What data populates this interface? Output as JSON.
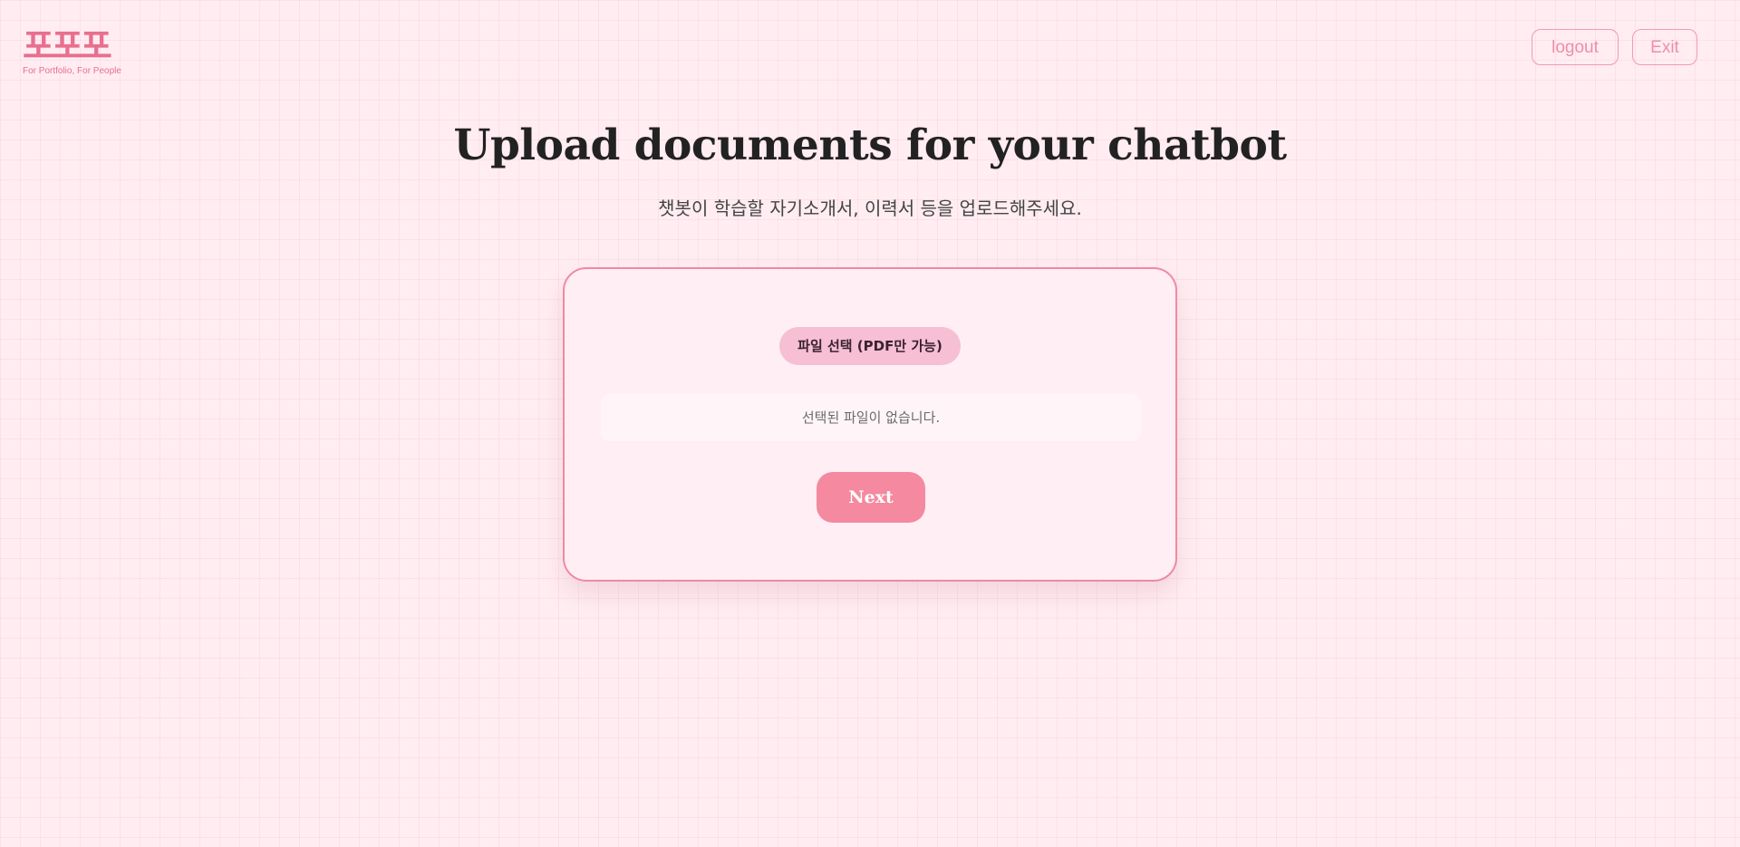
{
  "header": {
    "logo_mark": "포포포",
    "logo_tagline": "For Portfolio, For People",
    "logout_label": "logout",
    "exit_label": "Exit"
  },
  "main": {
    "title": "Upload documents for your chatbot",
    "subtitle": "챗봇이 학습할 자기소개서, 이력서 등을 업로드해주세요."
  },
  "upload": {
    "file_select_label": "파일 선택 (PDF만 가능)",
    "file_status": "선택된 파일이 없습니다.",
    "next_label": "Next"
  },
  "colors": {
    "background": "#ffedf2",
    "accent": "#e86f8f",
    "button_pink": "#f4899f",
    "file_button": "#f6bfd3",
    "card_border": "#ef8aa4"
  }
}
